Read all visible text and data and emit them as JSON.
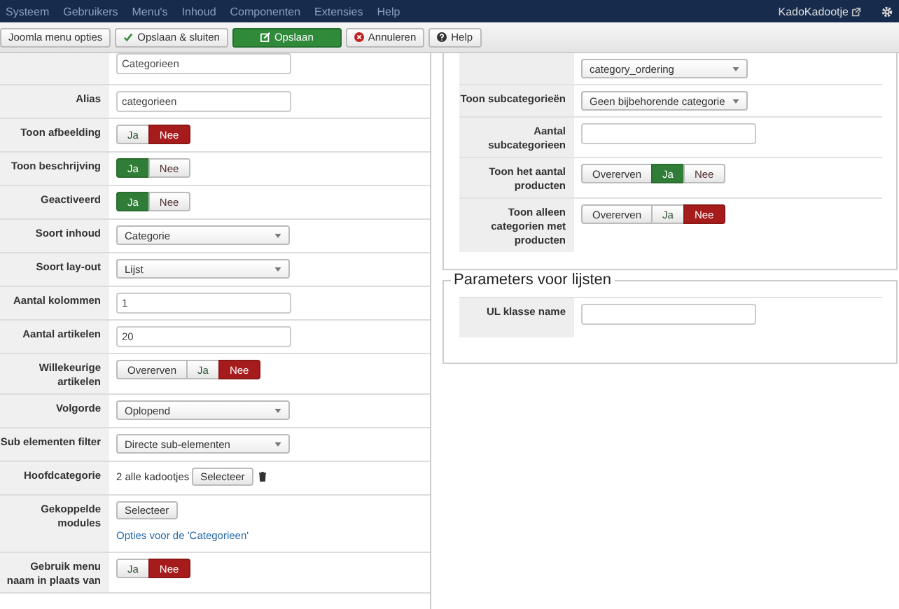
{
  "nav": {
    "items": [
      "Systeem",
      "Gebruikers",
      "Menu's",
      "Inhoud",
      "Componenten",
      "Extensies",
      "Help"
    ],
    "site": "KadoKadootje"
  },
  "toolbar": [
    {
      "label": "Joomla menu opties",
      "kind": "plain"
    },
    {
      "label": "Opslaan & sluiten",
      "kind": "save-close"
    },
    {
      "label": "Opslaan",
      "kind": "save"
    },
    {
      "label": "Annuleren",
      "kind": "cancel"
    },
    {
      "label": "Help",
      "kind": "help"
    }
  ],
  "left_fields": [
    {
      "kind": "text",
      "value": "Categorieen"
    },
    {
      "label": "Alias",
      "kind": "text",
      "value": "categorieen"
    },
    {
      "label": "Toon afbeelding",
      "kind": "toggle",
      "options": [
        {
          "label": "Ja",
          "kind": "yes",
          "selected": false
        },
        {
          "label": "Nee",
          "kind": "no",
          "selected": true
        }
      ]
    },
    {
      "label": "Toon beschrijving",
      "kind": "toggle",
      "options": [
        {
          "label": "Ja",
          "kind": "yes",
          "selected": true
        },
        {
          "label": "Nee",
          "kind": "no",
          "selected": false
        }
      ]
    },
    {
      "label": "Geactiveerd",
      "kind": "toggle",
      "options": [
        {
          "label": "Ja",
          "kind": "yes",
          "selected": true
        },
        {
          "label": "Nee",
          "kind": "no",
          "selected": false
        }
      ]
    },
    {
      "label": "Soort inhoud",
      "kind": "select",
      "value": "Categorie"
    },
    {
      "label": "Soort lay-out",
      "kind": "select",
      "value": "Lijst"
    },
    {
      "label": "Aantal kolommen",
      "kind": "text",
      "value": "1"
    },
    {
      "label": "Aantal artikelen",
      "kind": "text",
      "value": "20"
    },
    {
      "label": "Willekeurige artikelen",
      "kind": "toggle",
      "options": [
        {
          "label": "Overerven",
          "kind": "inherit",
          "selected": false
        },
        {
          "label": "Ja",
          "kind": "yes",
          "selected": false
        },
        {
          "label": "Nee",
          "kind": "no",
          "selected": true
        }
      ]
    },
    {
      "label": "Volgorde",
      "kind": "select",
      "value": "Oplopend"
    },
    {
      "label": "Sub elementen filter",
      "kind": "select",
      "value": "Directe sub-elementen"
    },
    {
      "label": "Hoofdcategorie",
      "kind": "category",
      "value": "2 alle kadootjes",
      "button": "Selecteer"
    },
    {
      "label": "Gekoppelde modules",
      "kind": "modules",
      "button": "Selecteer",
      "link": "Opties voor de 'Categorieen'"
    },
    {
      "label": "Gebruik menu naam in plaats van",
      "kind": "toggle",
      "options": [
        {
          "label": "Ja",
          "kind": "yes",
          "selected": false
        },
        {
          "label": "Nee",
          "kind": "no",
          "selected": true
        }
      ]
    }
  ],
  "right_fields": [
    {
      "kind": "select",
      "value": "category_ordering"
    },
    {
      "label": "Toon subcategorieën",
      "kind": "select",
      "value": "Geen bijbehorende categorie"
    },
    {
      "label": "Aantal subcategorieen",
      "kind": "text"
    },
    {
      "label": "Toon het aantal producten",
      "kind": "toggle",
      "options": [
        {
          "label": "Overerven",
          "kind": "inherit",
          "selected": false
        },
        {
          "label": "Ja",
          "kind": "yes",
          "selected": true
        },
        {
          "label": "Nee",
          "kind": "no",
          "selected": false
        }
      ]
    },
    {
      "label": "Toon alleen categorien met producten",
      "kind": "toggle",
      "options": [
        {
          "label": "Overerven",
          "kind": "inherit",
          "selected": false
        },
        {
          "label": "Ja",
          "kind": "yes",
          "selected": false
        },
        {
          "label": "Nee",
          "kind": "no",
          "selected": true
        }
      ]
    }
  ],
  "list_params": {
    "legend": "Parameters voor lijsten",
    "fields": [
      {
        "label": "UL klasse name",
        "kind": "text"
      }
    ]
  }
}
